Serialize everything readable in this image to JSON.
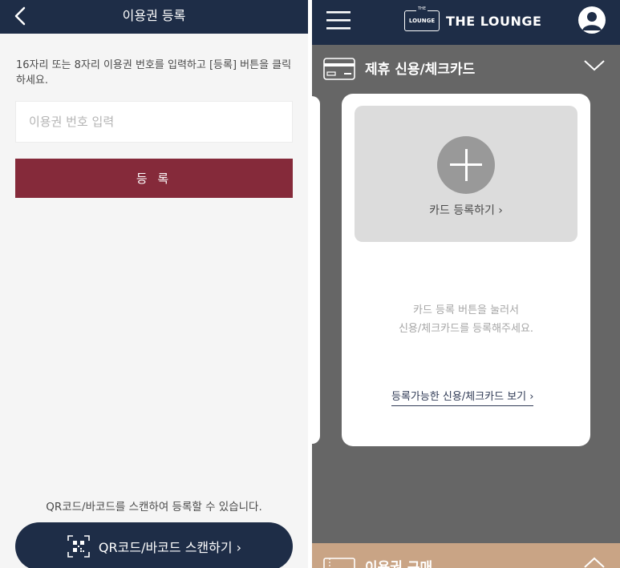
{
  "left": {
    "header": {
      "title": "이용권 등록"
    },
    "instruction": "16자리 또는 8자리 이용권 번호를 입력하고 [등록] 버튼을 클릭하세요.",
    "input": {
      "placeholder": "이용권 번호 입력",
      "value": ""
    },
    "register_label": "등 록",
    "qr_hint": "QR코드/바코드를 스캔하여 등록할 수 있습니다.",
    "qr_button_label": "QR코드/바코드 스캔하기 ›"
  },
  "right": {
    "header": {
      "logo_badge_small": "THE",
      "logo_badge_text": "LOUNGE",
      "logo_text": "THE LOUNGE"
    },
    "section": {
      "title": "제휴 신용/체크카드"
    },
    "card_slot_label": "카드 등록하기 ›",
    "empty_message_line1": "카드 등록 버튼을 눌러서",
    "empty_message_line2": "신용/체크카드를 등록해주세요.",
    "link_label": "등록가능한 신용/체크카드 보기 ›",
    "bottom_section": {
      "title": "이용권 구매"
    }
  },
  "colors": {
    "navy": "#1e2d47",
    "burgundy": "#852a3a",
    "gray_bg": "#666666",
    "tan": "#c9a485"
  },
  "icons": [
    "back-chevron-icon",
    "qr-scan-icon",
    "hamburger-menu-icon",
    "profile-icon",
    "credit-card-icon",
    "chevron-down-icon",
    "plus-icon",
    "ticket-icon",
    "chevron-up-icon"
  ]
}
